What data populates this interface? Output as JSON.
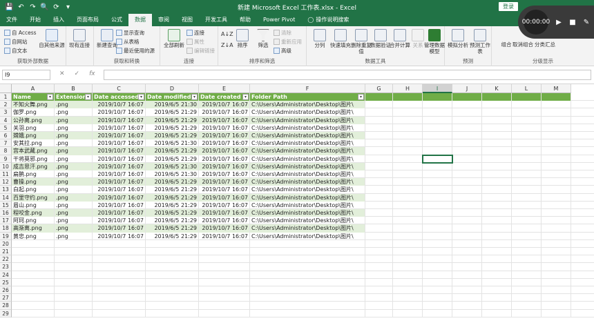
{
  "window": {
    "title": "新建 Microsoft Excel 工作表.xlsx  -  Excel",
    "login_label": "登录"
  },
  "recorder": {
    "time": "00:00:00"
  },
  "tabs": [
    {
      "label": "文件",
      "active": false
    },
    {
      "label": "开始",
      "active": false
    },
    {
      "label": "插入",
      "active": false
    },
    {
      "label": "页面布局",
      "active": false
    },
    {
      "label": "公式",
      "active": false
    },
    {
      "label": "数据",
      "active": true
    },
    {
      "label": "审阅",
      "active": false
    },
    {
      "label": "视图",
      "active": false
    },
    {
      "label": "开发工具",
      "active": false
    },
    {
      "label": "帮助",
      "active": false
    },
    {
      "label": "Power Pivot",
      "active": false
    }
  ],
  "tell_me": "操作说明搜索",
  "ribbon": {
    "groups": {
      "get_external": "获取外部数据",
      "get_transform": "获取和转换",
      "connections": "连接",
      "sort_filter": "排序和筛选",
      "data_tools": "数据工具",
      "forecast": "预测",
      "outline": "分级显示"
    },
    "buttons": {
      "from_access": "自 Access",
      "from_web": "自网站",
      "from_text": "自文本",
      "other_sources": "自其他来源",
      "existing_conn": "现有连接",
      "new_query": "新建查询",
      "show_queries": "显示查询",
      "from_table": "从表格",
      "recent_sources": "最近使用的源",
      "refresh_all": "全部刷新",
      "connections": "连接",
      "properties": "属性",
      "edit_links": "编辑链接",
      "sort": "排序",
      "filter": "筛选",
      "clear": "清除",
      "reapply": "重新应用",
      "advanced": "高级",
      "text_to_columns": "分列",
      "flash_fill": "快速填充",
      "remove_dup": "删除重复值",
      "data_validation": "数据验证",
      "consolidate": "合并计算",
      "relationships": "关系",
      "manage_model": "管理数据模型",
      "what_if": "模拟分析",
      "forecast_sheet": "预测工作表",
      "group": "组合",
      "ungroup": "取消组合",
      "subtotal": "分类汇总"
    }
  },
  "formula_bar": {
    "name_box": "I9",
    "cancel": "✕",
    "enter": "✓",
    "fx": "fx",
    "value": ""
  },
  "columns": [
    "A",
    "B",
    "C",
    "D",
    "E",
    "F",
    "G",
    "H",
    "I",
    "J",
    "K",
    "L",
    "M"
  ],
  "row_numbers": [
    "1",
    "2",
    "3",
    "4",
    "5",
    "6",
    "7",
    "8",
    "9",
    "10",
    "11",
    "12",
    "13",
    "14",
    "15",
    "16",
    "17",
    "18",
    "19",
    "20",
    "21",
    "22",
    "23",
    "24",
    "25",
    "26",
    "27",
    "28",
    "29"
  ],
  "table": {
    "headers": [
      "Name",
      "Extension",
      "Date accessed",
      "Date modified",
      "Date created",
      "Folder Path"
    ],
    "rows": [
      [
        "不知火舞.png",
        ".png",
        "2019/10/7 16:07",
        "2019/6/5 21:30",
        "2019/10/7 16:07",
        "C:\\Users\\Administrator\\Desktop\\图片\\"
      ],
      [
        "伽罗.png",
        ".png",
        "2019/10/7 16:07",
        "2019/6/5 21:29",
        "2019/10/7 16:07",
        "C:\\Users\\Administrator\\Desktop\\图片\\"
      ],
      [
        "公孙离.png",
        ".png",
        "2019/10/7 16:07",
        "2019/6/5 21:29",
        "2019/10/7 16:07",
        "C:\\Users\\Administrator\\Desktop\\图片\\"
      ],
      [
        "关羽.png",
        ".png",
        "2019/10/7 16:07",
        "2019/6/5 21:29",
        "2019/10/7 16:07",
        "C:\\Users\\Administrator\\Desktop\\图片\\"
      ],
      [
        "嫦娥.png",
        ".png",
        "2019/10/7 16:07",
        "2019/6/5 21:29",
        "2019/10/7 16:07",
        "C:\\Users\\Administrator\\Desktop\\图片\\"
      ],
      [
        "安其拉.png",
        ".png",
        "2019/10/7 16:07",
        "2019/6/5 21:30",
        "2019/10/7 16:07",
        "C:\\Users\\Administrator\\Desktop\\图片\\"
      ],
      [
        "宫本武藏.png",
        ".png",
        "2019/10/7 16:07",
        "2019/6/5 21:29",
        "2019/10/7 16:07",
        "C:\\Users\\Administrator\\Desktop\\图片\\"
      ],
      [
        "干将莫邪.png",
        ".png",
        "2019/10/7 16:07",
        "2019/6/5 21:29",
        "2019/10/7 16:07",
        "C:\\Users\\Administrator\\Desktop\\图片\\"
      ],
      [
        "成吉思汗.png",
        ".png",
        "2019/10/7 16:07",
        "2019/6/5 21:30",
        "2019/10/7 16:07",
        "C:\\Users\\Administrator\\Desktop\\图片\\"
      ],
      [
        "扁鹊.png",
        ".png",
        "2019/10/7 16:07",
        "2019/6/5 21:30",
        "2019/10/7 16:07",
        "C:\\Users\\Administrator\\Desktop\\图片\\"
      ],
      [
        "曹操.png",
        ".png",
        "2019/10/7 16:07",
        "2019/6/5 21:29",
        "2019/10/7 16:07",
        "C:\\Users\\Administrator\\Desktop\\图片\\"
      ],
      [
        "白起.png",
        ".png",
        "2019/10/7 16:07",
        "2019/6/5 21:29",
        "2019/10/7 16:07",
        "C:\\Users\\Administrator\\Desktop\\图片\\"
      ],
      [
        "百里守约.png",
        ".png",
        "2019/10/7 16:07",
        "2019/6/5 21:29",
        "2019/10/7 16:07",
        "C:\\Users\\Administrator\\Desktop\\图片\\"
      ],
      [
        "眉山.png",
        ".png",
        "2019/10/7 16:07",
        "2019/6/5 21:29",
        "2019/10/7 16:07",
        "C:\\Users\\Administrator\\Desktop\\图片\\"
      ],
      [
        "程咬金.png",
        ".png",
        "2019/10/7 16:07",
        "2019/6/5 21:29",
        "2019/10/7 16:07",
        "C:\\Users\\Administrator\\Desktop\\图片\\"
      ],
      [
        "阿珂.png",
        ".png",
        "2019/10/7 16:07",
        "2019/6/5 21:29",
        "2019/10/7 16:07",
        "C:\\Users\\Administrator\\Desktop\\图片\\"
      ],
      [
        "高渐离.png",
        ".png",
        "2019/10/7 16:07",
        "2019/6/5 21:29",
        "2019/10/7 16:07",
        "C:\\Users\\Administrator\\Desktop\\图片\\"
      ],
      [
        "黄忠.png",
        ".png",
        "2019/10/7 16:07",
        "2019/6/5 21:29",
        "2019/10/7 16:07",
        "C:\\Users\\Administrator\\Desktop\\图片\\"
      ]
    ]
  },
  "selected_cell": "I9",
  "colors": {
    "excel_green": "#217346",
    "table_header": "#70ad47",
    "table_band": "#e2efda"
  }
}
